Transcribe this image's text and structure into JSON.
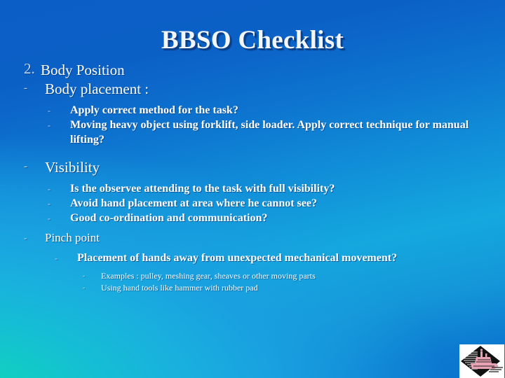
{
  "slide": {
    "title": "BBSO Checklist",
    "background": {
      "top_color": "#0b5ec6",
      "mid_color": "#19ace0",
      "bottom_left_color": "#11d3b8"
    },
    "text_color": "#ffffff",
    "title_shadow_color": "#0a3f87"
  },
  "outline": {
    "bullet_dash": "-",
    "section_number": "2.",
    "section_title": "Body Position",
    "groups": [
      {
        "heading": "Body placement :",
        "items": [
          "Apply correct method for the task?",
          "Moving heavy object using forklift, side loader. Apply correct technique for manual lifting?"
        ]
      },
      {
        "heading": "Visibility",
        "items": [
          "Is the observee attending to the task with full visibility?",
          "Avoid hand placement at area where he cannot see?",
          "Good co-ordination and communication?"
        ]
      },
      {
        "heading": "Pinch point",
        "items": [
          "Placement of hands away from unexpected mechanical movement?"
        ],
        "subitems": [
          "Examples : pulley, meshing gear, sheaves or other moving parts",
          "Using hand tools like hammer with rubber pad"
        ]
      }
    ]
  },
  "logo": {
    "name": "refinery-diamond-logo",
    "diamond_color": "#111111",
    "accent_color": "#e6a3b4"
  }
}
